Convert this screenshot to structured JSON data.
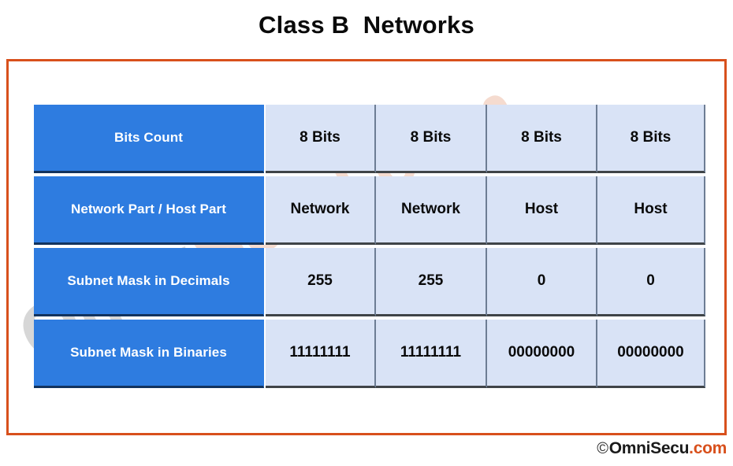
{
  "title": "Class B  Networks",
  "theme": {
    "frame_border": "#d8501c",
    "label_cell_bg": "#2e7ce0",
    "data_cell_bg": "#d9e3f6",
    "label_text": "#ffffff",
    "data_text": "#0a0a0a"
  },
  "watermark": {
    "part_1": "Omni",
    "part_2": "Secu.com"
  },
  "footer": {
    "copyright_symbol": "©",
    "brand_part_1": "OmniSecu",
    "brand_part_2": ".com"
  },
  "table": {
    "rows": [
      {
        "label": "Bits Count",
        "cells": [
          "8 Bits",
          "8 Bits",
          "8 Bits",
          "8 Bits"
        ]
      },
      {
        "label": "Network Part / Host Part",
        "cells": [
          "Network",
          "Network",
          "Host",
          "Host"
        ]
      },
      {
        "label": "Subnet Mask in Decimals",
        "cells": [
          "255",
          "255",
          "0",
          "0"
        ]
      },
      {
        "label": "Subnet Mask in Binaries",
        "cells": [
          "11111111",
          "11111111",
          "00000000",
          "00000000"
        ]
      }
    ]
  }
}
